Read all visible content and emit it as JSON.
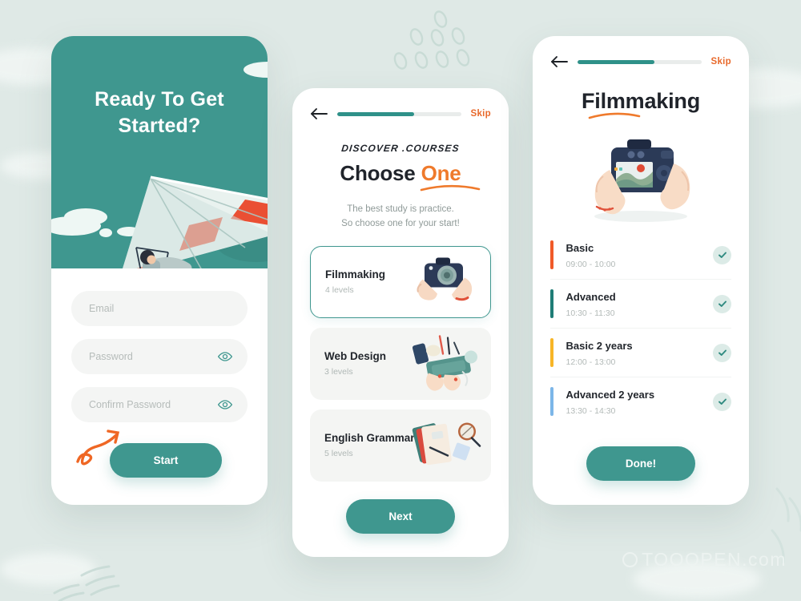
{
  "canvas": {
    "background_color": "#dfe9e6",
    "watermark": "TOOOPEN.com"
  },
  "palette": {
    "teal": "#3f978f",
    "teal_dark": "#2f9189",
    "orange": "#e8692b",
    "orange_accent": "#ef7a2c",
    "ink": "#20242b",
    "muted": "#b0b8b6",
    "field_bg": "#f4f5f4"
  },
  "screen_signup": {
    "hero_title": "Ready To Get Started?",
    "fields": [
      {
        "name": "email",
        "placeholder": "Email",
        "value": "",
        "has_eye": false
      },
      {
        "name": "password",
        "placeholder": "Password",
        "value": "",
        "has_eye": true
      },
      {
        "name": "confirm_password",
        "placeholder": "Confirm Password",
        "value": "",
        "has_eye": true
      }
    ],
    "eye_icon": "eye-icon",
    "submit_label": "Start",
    "arrow_doodle": "curly-arrow-icon"
  },
  "screen_choose": {
    "back_icon": "arrow-left-icon",
    "progress_percent": 62,
    "skip_label": "Skip",
    "kicker": "DISCOVER .COURSES",
    "headline_plain": "Choose ",
    "headline_accent": "One",
    "subtext_line1": "The best study is practice.",
    "subtext_line2": "So choose one for your start!",
    "courses": [
      {
        "title": "Filmmaking",
        "levels": "4 levels",
        "selected": true,
        "art": "camera-hands-illustration"
      },
      {
        "title": "Web Design",
        "levels": "3 levels",
        "selected": false,
        "art": "keyboard-desk-illustration"
      },
      {
        "title": "English Grammar",
        "levels": "5 levels",
        "selected": false,
        "art": "books-magnifier-illustration"
      }
    ],
    "next_label": "Next"
  },
  "screen_detail": {
    "back_icon": "arrow-left-icon",
    "progress_percent": 62,
    "skip_label": "Skip",
    "title": "Filmmaking",
    "title_underline": "orange-swoosh-icon",
    "hero_art": "dslr-camera-hands-illustration",
    "lessons": [
      {
        "name": "Basic",
        "time": "09:00 - 10:00",
        "bar_color": "#f05a28",
        "checked": true
      },
      {
        "name": "Advanced",
        "time": "10:30 - 11:30",
        "bar_color": "#1f7d76",
        "checked": true
      },
      {
        "name": "Basic 2 years",
        "time": "12:00 - 13:00",
        "bar_color": "#f7b527",
        "checked": true
      },
      {
        "name": "Advanced 2 years",
        "time": "13:30 - 14:30",
        "bar_color": "#7cb6e8",
        "checked": true
      }
    ],
    "check_icon": "check-icon",
    "done_label": "Done!"
  }
}
